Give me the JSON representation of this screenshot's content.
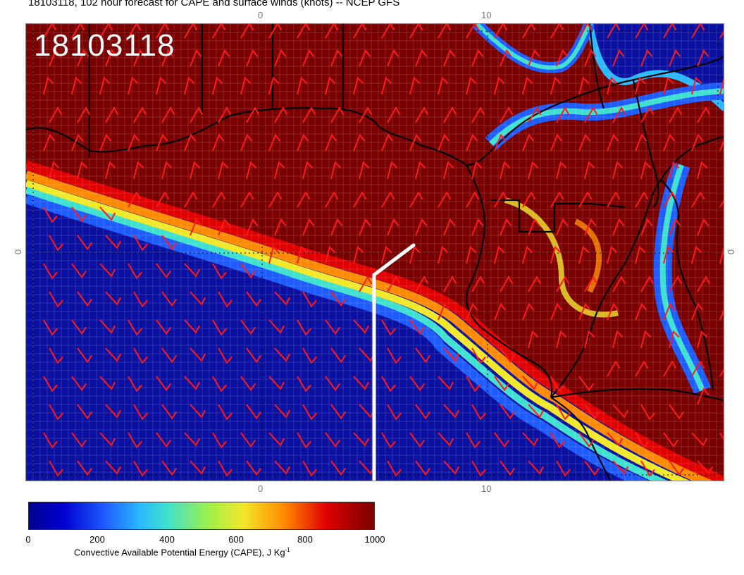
{
  "header": {
    "title": "18103118, 102 hour forecast for CAPE and surface winds (knots) -- NCEP GFS",
    "panel_label": "18103118"
  },
  "axes": {
    "top_ticks": [
      "0",
      "10"
    ],
    "bottom_ticks": [
      "0",
      "10"
    ],
    "left_tick": "0",
    "right_tick": "0"
  },
  "colorbar": {
    "ticks": [
      "0",
      "200",
      "400",
      "600",
      "800",
      "1000"
    ],
    "label": "Convective Available Potential Energy (CAPE), J Kg",
    "label_sup": "-1",
    "colors": [
      "#00008f",
      "#0000d0",
      "#1f5cff",
      "#2ab8ff",
      "#3fe0d0",
      "#9ef04a",
      "#f2e82a",
      "#ff8a00",
      "#e00000",
      "#7a0000"
    ]
  },
  "map": {
    "field_high_color": "#7a0000",
    "field_low_color": "#0a10a0",
    "barb_color": "#ff1a1a",
    "coast_color": "#000000",
    "cross_section_color": "#ffffff"
  }
}
